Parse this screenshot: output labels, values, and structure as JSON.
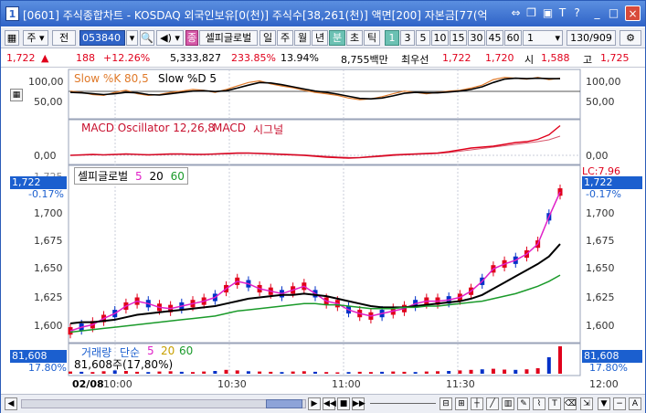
{
  "window": {
    "app_number": "1",
    "title": "[0601] 주식종합차트 - KOSDAQ 외국인보유[0(천)] 주식수[38,261(천)] 액면[200] 자본금[77(억"
  },
  "toolbar": {
    "type_select": "주",
    "mode_select": "전",
    "code_value": "053840",
    "zoom_icon": "🔍",
    "indicator_badge": "종",
    "indicator_name": "셀피글로벌",
    "period_buttons": [
      "일",
      "주",
      "월",
      "년",
      "분",
      "초",
      "틱"
    ],
    "minute_buttons": [
      "1",
      "3",
      "5",
      "10",
      "15",
      "30",
      "45",
      "60"
    ],
    "unit_value": "1",
    "page_count": "130/909"
  },
  "quote": {
    "price": "1,722",
    "arrow": "▲",
    "change": "188",
    "change_rate": "+12.26%",
    "volume": "5,333,827",
    "vol_rate": "233.85%",
    "turnover": "13.94%",
    "amount": "8,755백만",
    "best_ask_label": "최우선",
    "best_ask": "1,722",
    "best_bid": "1,720",
    "open_label": "시",
    "open": "1,588",
    "high_label": "고",
    "high": "1,725"
  },
  "stoch_panel": {
    "title_k": "Slow %K 80,5",
    "title_d": "Slow %D 5",
    "ticks": [
      "100,00",
      "50,00"
    ]
  },
  "macd_panel": {
    "title_osc": "MACD Oscillator 12,26,8",
    "title_macd": "MACD",
    "title_signal": "시그널",
    "ticks": [
      "0,00"
    ]
  },
  "price_panel": {
    "legend_name": "셀피글로벌",
    "legend_ma": [
      "5",
      "20",
      "60"
    ],
    "current": "1,722",
    "current_rate": "-0.17%",
    "top_label": "1,725",
    "lc_label": "LC:7.96",
    "ticks": [
      "1,700",
      "1,675",
      "1,650",
      "1,625",
      "1,600"
    ]
  },
  "volume_panel": {
    "title": "거래량",
    "title_ma_label": "단순",
    "ma": [
      "5",
      "20",
      "60"
    ],
    "detail": "81,608주(17,80%)",
    "current": "81,608",
    "current_rate": "17.80%"
  },
  "time_axis": {
    "date": "02/08",
    "labels": [
      "10:00",
      "10:30",
      "11:00",
      "11:30",
      "12:00"
    ]
  },
  "colors": {
    "up": "#e0001b",
    "down": "#0030c8",
    "ma5": "#e020c8",
    "ma20": "#000000",
    "ma60": "#1a9a2a",
    "accent": "#2f63c7"
  },
  "chart_data": [
    {
      "type": "line",
      "title": "Slow %K 80,5 / Slow %D 5",
      "ylim": [
        0,
        100
      ],
      "series": [
        {
          "name": "Slow %K 80,5",
          "values": [
            58,
            55,
            50,
            48,
            55,
            60,
            52,
            48,
            50,
            55,
            58,
            62,
            60,
            55,
            62,
            70,
            78,
            82,
            75,
            70,
            66,
            60,
            55,
            52,
            48,
            42,
            38,
            40,
            45,
            52,
            58,
            55,
            52,
            55,
            58,
            60,
            65,
            72,
            85,
            90,
            88,
            86,
            90,
            85,
            88
          ]
        },
        {
          "name": "Slow %D 5",
          "values": [
            55,
            54,
            52,
            50,
            52,
            55,
            54,
            50,
            49,
            52,
            55,
            58,
            59,
            57,
            59,
            65,
            72,
            78,
            77,
            73,
            68,
            63,
            58,
            55,
            51,
            46,
            41,
            40,
            42,
            47,
            53,
            55,
            54,
            54,
            56,
            58,
            62,
            68,
            78,
            86,
            88,
            87,
            88,
            87,
            87
          ]
        }
      ]
    },
    {
      "type": "line",
      "title": "MACD Oscillator 12,26,8 / MACD / 시그널",
      "series": [
        {
          "name": "MACD",
          "values": [
            0,
            0.1,
            0.2,
            0.1,
            0.2,
            0.3,
            0.2,
            0.1,
            0.2,
            0.3,
            0.3,
            0.2,
            0.2,
            0.3,
            0.4,
            0.5,
            0.5,
            0.4,
            0.3,
            0.2,
            0.1,
            0,
            -0.2,
            -0.4,
            -0.5,
            -0.6,
            -0.5,
            -0.3,
            -0.1,
            0.1,
            0.2,
            0.3,
            0.4,
            0.5,
            0.8,
            1.2,
            1.6,
            1.8,
            2.0,
            2.4,
            2.8,
            3.0,
            3.5,
            4.5,
            6.5
          ]
        },
        {
          "name": "시그널",
          "values": [
            0,
            0.05,
            0.1,
            0.1,
            0.15,
            0.2,
            0.2,
            0.15,
            0.15,
            0.2,
            0.25,
            0.25,
            0.22,
            0.25,
            0.3,
            0.4,
            0.45,
            0.45,
            0.4,
            0.3,
            0.2,
            0.1,
            -0.05,
            -0.2,
            -0.35,
            -0.45,
            -0.5,
            -0.4,
            -0.25,
            -0.05,
            0.1,
            0.2,
            0.3,
            0.4,
            0.6,
            0.9,
            1.2,
            1.5,
            1.8,
            2.1,
            2.4,
            2.7,
            3.0,
            3.4,
            4.2
          ]
        }
      ]
    },
    {
      "type": "line",
      "title": "셀피글로벌",
      "ylim": [
        1590,
        1730
      ],
      "series": [
        {
          "name": "5",
          "values": [
            1598,
            1601,
            1603,
            1608,
            1612,
            1618,
            1622,
            1620,
            1617,
            1616,
            1618,
            1620,
            1622,
            1625,
            1632,
            1638,
            1636,
            1632,
            1630,
            1628,
            1631,
            1634,
            1628,
            1622,
            1620,
            1615,
            1612,
            1610,
            1612,
            1614,
            1616,
            1620,
            1622,
            1622,
            1623,
            1625,
            1630,
            1638,
            1648,
            1652,
            1655,
            1660,
            1668,
            1690,
            1710
          ]
        },
        {
          "name": "20",
          "values": [
            1604,
            1605,
            1605,
            1606,
            1607,
            1609,
            1611,
            1612,
            1613,
            1614,
            1615,
            1616,
            1617,
            1618,
            1620,
            1622,
            1624,
            1625,
            1626,
            1627,
            1627,
            1628,
            1627,
            1626,
            1624,
            1622,
            1620,
            1618,
            1617,
            1617,
            1617,
            1618,
            1619,
            1620,
            1621,
            1622,
            1624,
            1627,
            1632,
            1637,
            1642,
            1647,
            1652,
            1658,
            1668
          ]
        },
        {
          "name": "60",
          "values": [
            1597,
            1598,
            1599,
            1600,
            1601,
            1602,
            1603,
            1604,
            1605,
            1606,
            1607,
            1608,
            1609,
            1610,
            1612,
            1614,
            1615,
            1616,
            1617,
            1618,
            1619,
            1620,
            1620,
            1619,
            1619,
            1618,
            1617,
            1616,
            1616,
            1616,
            1617,
            1617,
            1618,
            1618,
            1619,
            1620,
            1621,
            1622,
            1624,
            1626,
            1628,
            1631,
            1634,
            1638,
            1643
          ]
        }
      ]
    },
    {
      "type": "bar",
      "title": "거래량 단순 5 20 60",
      "values": [
        8,
        7,
        6,
        9,
        12,
        10,
        7,
        6,
        8,
        9,
        7,
        6,
        8,
        10,
        14,
        12,
        9,
        8,
        7,
        6,
        8,
        9,
        7,
        6,
        5,
        6,
        7,
        6,
        7,
        8,
        7,
        6,
        8,
        9,
        10,
        12,
        14,
        16,
        18,
        15,
        14,
        16,
        20,
        60,
        100
      ]
    }
  ]
}
